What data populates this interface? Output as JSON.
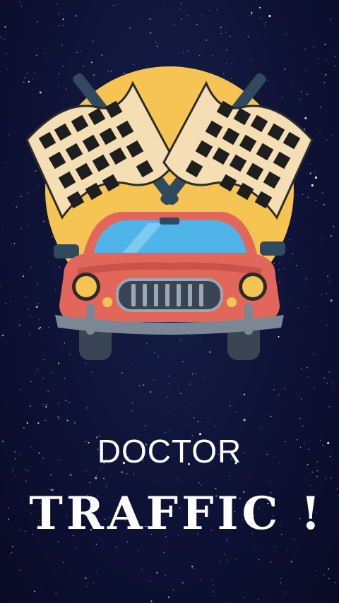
{
  "splash": {
    "title_line1": "DOCTOR",
    "title_line2": "TRAFFIC !"
  },
  "logo": {
    "icon": "race-car-with-checkered-flags",
    "sun_color": "#f6c453",
    "car_color": "#e2675a",
    "windshield_color": "#4fb4e8"
  },
  "background": {
    "style": "starry-night",
    "color": "#0d1030"
  }
}
